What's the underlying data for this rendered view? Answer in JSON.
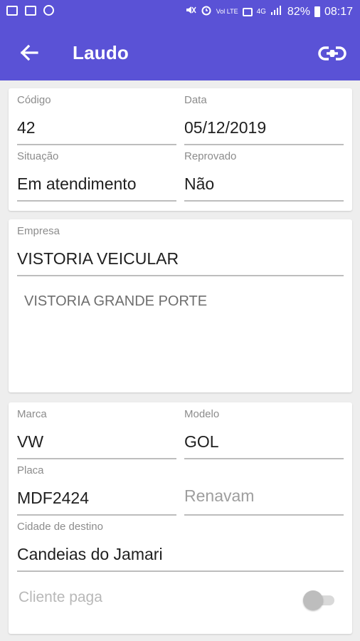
{
  "status_bar": {
    "battery": "82%",
    "time": "08:17",
    "icons": [
      "image-icon",
      "laptop-icon",
      "dnd-icon",
      "mute-icon",
      "alarm-icon",
      "volte-icon",
      "sim-icon",
      "4g-icon",
      "signal-icon",
      "battery-icon"
    ],
    "volte_label": "Vol LTE",
    "net_label": "4G"
  },
  "app_bar": {
    "title": "Laudo",
    "color": "#5a52d6"
  },
  "card_info": {
    "codigo": {
      "label": "Código",
      "value": "42"
    },
    "data": {
      "label": "Data",
      "value": "05/12/2019"
    },
    "situacao": {
      "label": "Situação",
      "value": "Em atendimento"
    },
    "reprovado": {
      "label": "Reprovado",
      "value": "Não"
    }
  },
  "card_empresa": {
    "empresa": {
      "label": "Empresa",
      "value": "VISTORIA VEICULAR"
    },
    "descricao": "VISTORIA GRANDE PORTE"
  },
  "card_veiculo": {
    "marca": {
      "label": "Marca",
      "value": "VW"
    },
    "modelo": {
      "label": "Modelo",
      "value": "GOL"
    },
    "placa": {
      "label": "Placa",
      "value": "MDF2424"
    },
    "renavam": {
      "placeholder": "Renavam"
    },
    "cidade": {
      "label": "Cidade de destino",
      "value": "Candeias do Jamari"
    },
    "cliente_paga": {
      "label": "Cliente paga",
      "checked": false
    }
  }
}
